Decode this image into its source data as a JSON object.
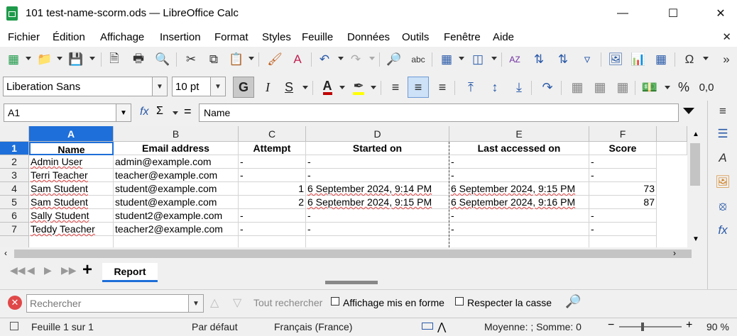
{
  "window": {
    "title": "101 test-name-scorm.ods — LibreOffice Calc"
  },
  "menu": [
    "Fichier",
    "Édition",
    "Affichage",
    "Insertion",
    "Format",
    "Styles",
    "Feuille",
    "Données",
    "Outils",
    "Fenêtre",
    "Aide"
  ],
  "formatting": {
    "font_name": "Liberation Sans",
    "font_size": "10 pt",
    "font_color": "#c00000",
    "highlight_color": "#ffff00"
  },
  "formula_bar": {
    "cell_ref": "A1",
    "content": "Name"
  },
  "columns": [
    "A",
    "B",
    "C",
    "D",
    "E",
    "F"
  ],
  "rows": [
    "1",
    "2",
    "3",
    "4",
    "5",
    "6",
    "7"
  ],
  "table": {
    "headers": [
      "Name",
      "Email address",
      "Attempt",
      "Started on",
      "Last accessed on",
      "Score"
    ],
    "data": [
      [
        "Admin User",
        "admin@example.com",
        "-",
        "-",
        "-",
        "-"
      ],
      [
        "Terri Teacher",
        "teacher@example.com",
        "-",
        "-",
        "-",
        "-"
      ],
      [
        "Sam Student",
        "student@example.com",
        "1",
        "6 September 2024, 9:14 PM",
        "6 September 2024, 9:15 PM",
        "73"
      ],
      [
        "Sam Student",
        "student@example.com",
        "2",
        "6 September 2024, 9:15 PM",
        "6 September 2024, 9:16 PM",
        "87"
      ],
      [
        "Sally Student",
        "student2@example.com",
        "-",
        "-",
        "-",
        "-"
      ],
      [
        "Teddy Teacher",
        "teacher2@example.com",
        "-",
        "-",
        "-",
        "-"
      ]
    ]
  },
  "sheet_tab": "Report",
  "find": {
    "placeholder": "Rechercher",
    "find_all": "Tout rechercher",
    "formatted_display": "Affichage mis en forme",
    "match_case": "Respecter la casse"
  },
  "status": {
    "sheet": "Feuille 1 sur 1",
    "page_style": "Par défaut",
    "language": "Français (France)",
    "summary": "Moyenne: ; Somme: 0",
    "zoom": "90 %"
  }
}
